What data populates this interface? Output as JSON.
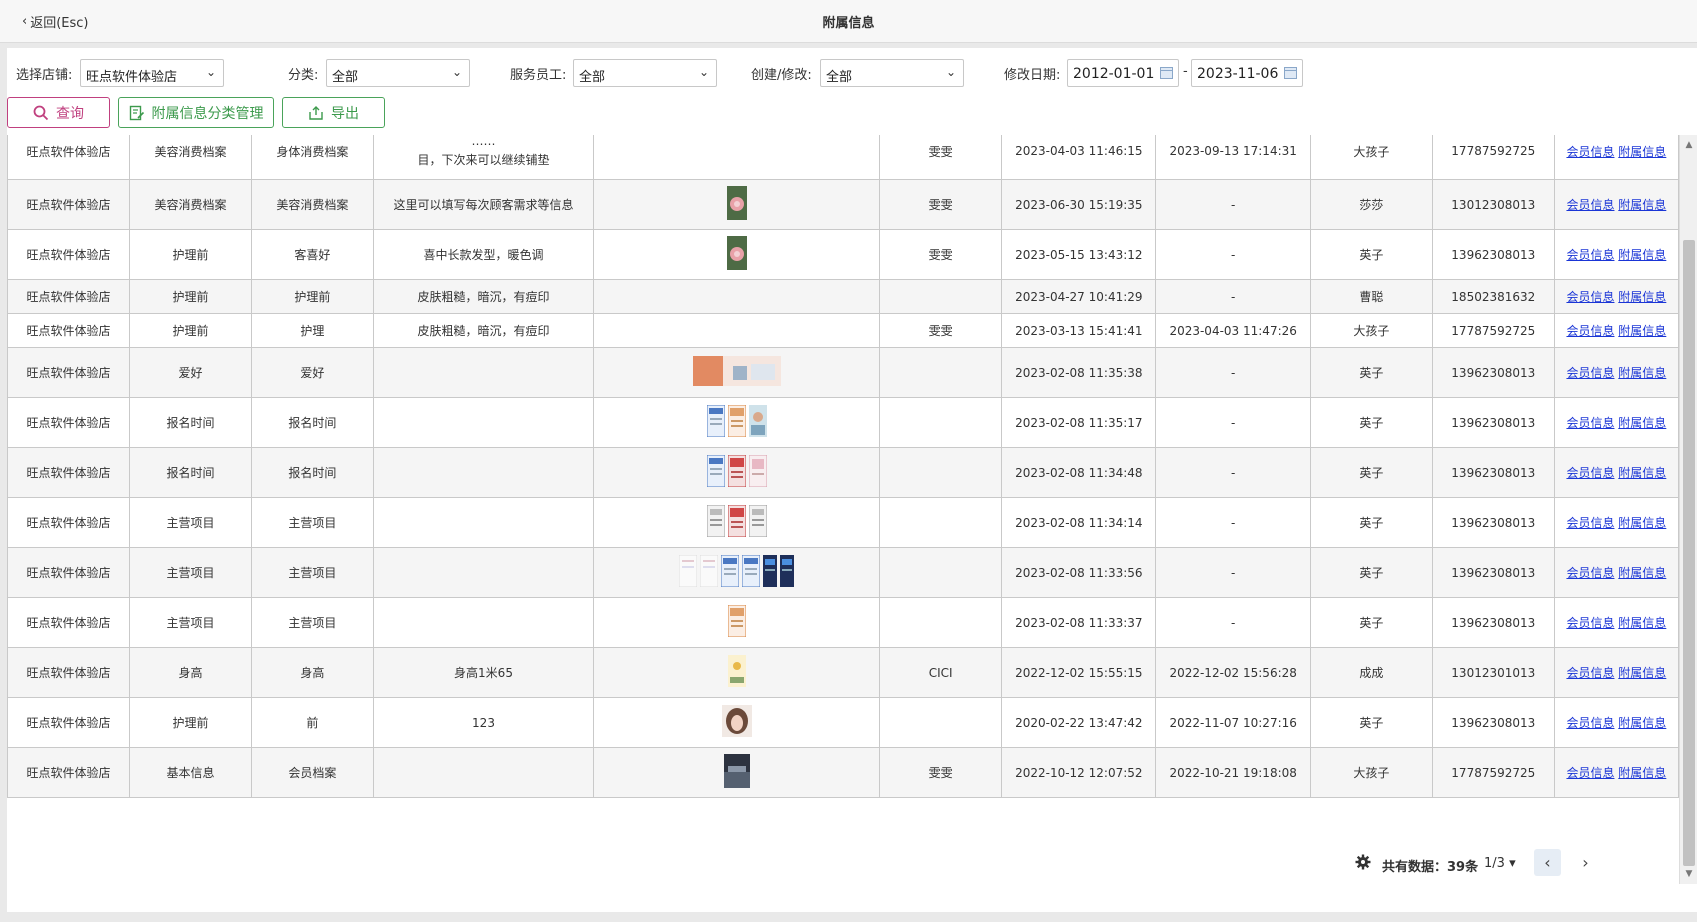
{
  "header": {
    "back_label": "返回(Esc)",
    "title": "附属信息"
  },
  "filters": {
    "store_label": "选择店铺:",
    "store_value": "旺点软件体验店",
    "category_label": "分类:",
    "category_value": "全部",
    "staff_label": "服务员工:",
    "staff_value": "全部",
    "mode_label": "创建/修改:",
    "mode_value": "全部",
    "date_label": "修改日期:",
    "date_from": "2012-01-01",
    "date_sep": "-",
    "date_to": "2023-11-06"
  },
  "buttons": {
    "query": "查询",
    "category_manage": "附属信息分类管理",
    "export": "导出"
  },
  "rows": [
    {
      "store": "旺点软件体验店",
      "category": "美容消费档案",
      "sub": "身体消费档案",
      "content": "目，下次来可以继续铺垫",
      "content_top": "……",
      "images": [],
      "creator": "雯雯",
      "created": "2023-04-03 11:46:15",
      "modified": "2023-09-13 17:14:31",
      "staff": "大孩子",
      "phone": "17787592725",
      "link1": "会员信息",
      "link2": "附属信息"
    },
    {
      "store": "旺点软件体验店",
      "category": "美容消费档案",
      "sub": "美容消费档案",
      "content": "这里可以填写每次顾客需求等信息",
      "images": [
        "flower"
      ],
      "creator": "雯雯",
      "created": "2023-06-30 15:19:35",
      "modified": "-",
      "staff": "莎莎",
      "phone": "13012308013",
      "link1": "会员信息",
      "link2": "附属信息"
    },
    {
      "store": "旺点软件体验店",
      "category": "护理前",
      "sub": "客喜好",
      "content": "喜中长款发型，暖色调",
      "images": [
        "flower"
      ],
      "creator": "雯雯",
      "created": "2023-05-15 13:43:12",
      "modified": "-",
      "staff": "英子",
      "phone": "13962308013",
      "link1": "会员信息",
      "link2": "附属信息"
    },
    {
      "store": "旺点软件体验店",
      "category": "护理前",
      "sub": "护理前",
      "content": "皮肤粗糙，暗沉，有痘印",
      "images": [],
      "creator": "",
      "created": "2023-04-27 10:41:29",
      "modified": "-",
      "staff": "曹聪",
      "phone": "18502381632",
      "link1": "会员信息",
      "link2": "附属信息"
    },
    {
      "store": "旺点软件体验店",
      "category": "护理前",
      "sub": "护理",
      "content": "皮肤粗糙，暗沉，有痘印",
      "images": [],
      "creator": "雯雯",
      "created": "2023-03-13 15:41:41",
      "modified": "2023-04-03 11:47:26",
      "staff": "大孩子",
      "phone": "17787592725",
      "link1": "会员信息",
      "link2": "附属信息"
    },
    {
      "store": "旺点软件体验店",
      "category": "爱好",
      "sub": "爱好",
      "content": "",
      "images": [
        "banner"
      ],
      "creator": "",
      "created": "2023-02-08 11:35:38",
      "modified": "-",
      "staff": "英子",
      "phone": "13962308013",
      "link1": "会员信息",
      "link2": "附属信息"
    },
    {
      "store": "旺点软件体验店",
      "category": "报名时间",
      "sub": "报名时间",
      "content": "",
      "images": [
        "doc-blue",
        "doc-orange",
        "doc-photo"
      ],
      "creator": "",
      "created": "2023-02-08 11:35:17",
      "modified": "-",
      "staff": "英子",
      "phone": "13962308013",
      "link1": "会员信息",
      "link2": "附属信息"
    },
    {
      "store": "旺点软件体验店",
      "category": "报名时间",
      "sub": "报名时间",
      "content": "",
      "images": [
        "doc-blue",
        "doc-red",
        "doc-pink"
      ],
      "creator": "",
      "created": "2023-02-08 11:34:48",
      "modified": "-",
      "staff": "英子",
      "phone": "13962308013",
      "link1": "会员信息",
      "link2": "附属信息"
    },
    {
      "store": "旺点软件体验店",
      "category": "主营项目",
      "sub": "主营项目",
      "content": "",
      "images": [
        "doc-gray",
        "doc-red",
        "doc-gray"
      ],
      "creator": "",
      "created": "2023-02-08 11:34:14",
      "modified": "-",
      "staff": "英子",
      "phone": "13962308013",
      "link1": "会员信息",
      "link2": "附属信息"
    },
    {
      "store": "旺点软件体验店",
      "category": "主营项目",
      "sub": "主营项目",
      "content": "",
      "images": [
        "doc-light",
        "doc-light",
        "doc-blue",
        "doc-blue",
        "doc-navy",
        "doc-navy"
      ],
      "creator": "",
      "created": "2023-02-08 11:33:56",
      "modified": "-",
      "staff": "英子",
      "phone": "13962308013",
      "link1": "会员信息",
      "link2": "附属信息"
    },
    {
      "store": "旺点软件体验店",
      "category": "主营项目",
      "sub": "主营项目",
      "content": "",
      "images": [
        "doc-orange"
      ],
      "creator": "",
      "created": "2023-02-08 11:33:37",
      "modified": "-",
      "staff": "英子",
      "phone": "13962308013",
      "link1": "会员信息",
      "link2": "附属信息"
    },
    {
      "store": "旺点软件体验店",
      "category": "身高",
      "sub": "身高",
      "content": "身高1米65",
      "images": [
        "doc-yellow"
      ],
      "creator": "CICI",
      "created": "2022-12-02 15:55:15",
      "modified": "2022-12-02 15:56:28",
      "staff": "成成",
      "phone": "13012301013",
      "link1": "会员信息",
      "link2": "附属信息"
    },
    {
      "store": "旺点软件体验店",
      "category": "护理前",
      "sub": "前",
      "content": "123",
      "images": [
        "face"
      ],
      "creator": "",
      "created": "2020-02-22 13:47:42",
      "modified": "2022-11-07 10:27:16",
      "staff": "英子",
      "phone": "13962308013",
      "link1": "会员信息",
      "link2": "附属信息"
    },
    {
      "store": "旺点软件体验店",
      "category": "基本信息",
      "sub": "会员档案",
      "content": "",
      "images": [
        "landscape"
      ],
      "creator": "雯雯",
      "created": "2022-10-12 12:07:52",
      "modified": "2022-10-21 19:18:08",
      "staff": "大孩子",
      "phone": "17787592725",
      "link1": "会员信息",
      "link2": "附属信息"
    }
  ],
  "footer": {
    "total_label": "共有数据：39条",
    "page_label": "1/3"
  },
  "colors": {
    "query": "#c0407f",
    "green": "#3c9a4c",
    "link": "#1a35d6"
  }
}
